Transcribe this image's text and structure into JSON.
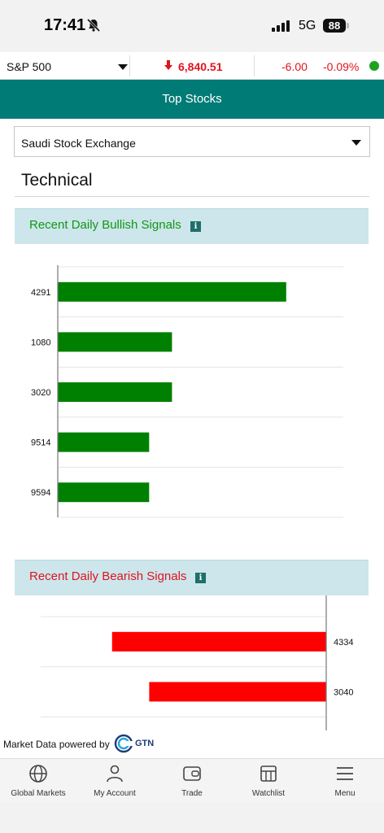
{
  "status_bar": {
    "time": "17:41",
    "network": "5G",
    "battery": "88"
  },
  "ticker": {
    "index_name": "S&P 500",
    "value": "6,840.51",
    "change": "-6.00",
    "change_pct": "-0.09%",
    "direction": "down",
    "status_color": "#1ea11e"
  },
  "header": {
    "title": "Top Stocks"
  },
  "exchange_select": {
    "selected": "Saudi Stock Exchange"
  },
  "section": {
    "title": "Technical"
  },
  "bullish": {
    "title": "Recent Daily Bullish Signals",
    "info_icon": "i",
    "color": "#119811",
    "bar_color": "#008000"
  },
  "bearish": {
    "title": "Recent Daily Bearish Signals",
    "info_icon": "i",
    "color": "#e0141e",
    "bar_color": "#ff0000"
  },
  "chart_data": [
    {
      "type": "bar",
      "orientation": "horizontal",
      "categories": [
        "4291",
        "1080",
        "3020",
        "9514",
        "9594"
      ],
      "values": [
        4,
        2,
        2,
        1.6,
        1.6
      ],
      "xlim": [
        0,
        5
      ],
      "grid": true,
      "xlabel": "",
      "ylabel": ""
    },
    {
      "type": "bar",
      "orientation": "horizontal-reversed",
      "categories": [
        "4334",
        "3040"
      ],
      "values": [
        3.75,
        3.1
      ],
      "xlim": [
        0,
        5
      ],
      "grid": true,
      "xlabel": "",
      "ylabel": ""
    }
  ],
  "footer": {
    "powered_text": "Market Data powered by",
    "brand": "GTN"
  },
  "nav": [
    {
      "label": "Global Markets",
      "icon": "globe-icon"
    },
    {
      "label": "My Account",
      "icon": "user-icon"
    },
    {
      "label": "Trade",
      "icon": "wallet-icon"
    },
    {
      "label": "Watchlist",
      "icon": "watchlist-icon"
    },
    {
      "label": "Menu",
      "icon": "menu-icon"
    }
  ]
}
